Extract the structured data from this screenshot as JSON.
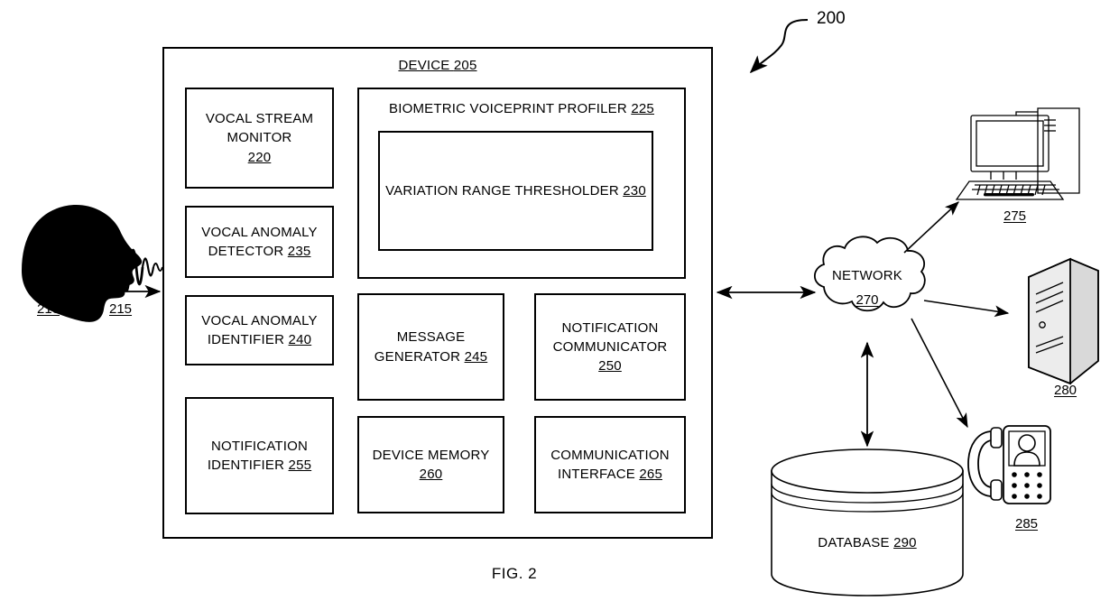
{
  "figure": {
    "caption": "FIG. 2",
    "system_ref": "200"
  },
  "source": {
    "speaker_ref": "210",
    "vocal_stream_ref": "215",
    "speaker_icon": "head-silhouette-icon",
    "waveform_icon": "audio-waveform-icon"
  },
  "device": {
    "title_text": "DEVICE",
    "title_ref": "205",
    "left_column": [
      {
        "name": "vocal-stream-monitor",
        "lines": [
          "VOCAL STREAM",
          "MONITOR"
        ],
        "ref": "220",
        "ref_on_own_line": true
      },
      {
        "name": "vocal-anomaly-detector",
        "lines": [
          "VOCAL ANOMALY",
          "DETECTOR"
        ],
        "ref": "235",
        "ref_on_own_line": false
      },
      {
        "name": "vocal-anomaly-identifier",
        "lines": [
          "VOCAL ANOMALY",
          "IDENTIFIER"
        ],
        "ref": "240",
        "ref_on_own_line": false
      },
      {
        "name": "notification-identifier",
        "lines": [
          "NOTIFICATION",
          "IDENTIFIER"
        ],
        "ref": "255",
        "ref_on_own_line": false
      }
    ],
    "profiler": {
      "title_text": "BIOMETRIC VOICEPRINT PROFILER",
      "title_ref": "225",
      "inner": {
        "title_text": "VARIATION RANGE THRESHOLDER",
        "title_ref": "230"
      }
    },
    "middle_column": [
      {
        "name": "message-generator",
        "lines": [
          "MESSAGE",
          "GENERATOR"
        ],
        "ref": "245",
        "ref_on_own_line": false
      },
      {
        "name": "device-memory",
        "lines": [
          "DEVICE MEMORY"
        ],
        "ref": "260",
        "ref_on_own_line": true
      }
    ],
    "right_column": [
      {
        "name": "notification-communicator",
        "lines": [
          "NOTIFICATION",
          "COMMUNICATOR"
        ],
        "ref": "250",
        "ref_on_own_line": true
      },
      {
        "name": "communication-interface",
        "lines": [
          "COMMUNICATION",
          "INTERFACE"
        ],
        "ref": "265",
        "ref_on_own_line": false
      }
    ]
  },
  "network": {
    "label_text": "NETWORK",
    "ref": "270",
    "icon": "cloud-icon"
  },
  "endpoints": [
    {
      "name": "desktop-computer",
      "ref": "275",
      "icon": "desktop-computer-icon"
    },
    {
      "name": "server",
      "ref": "280",
      "icon": "server-icon"
    },
    {
      "name": "videophone",
      "ref": "285",
      "icon": "videophone-icon"
    }
  ],
  "database": {
    "label_text": "DATABASE",
    "ref": "290",
    "icon": "database-cylinder-icon"
  },
  "colors": {
    "line": "#000000",
    "background": "#ffffff"
  }
}
